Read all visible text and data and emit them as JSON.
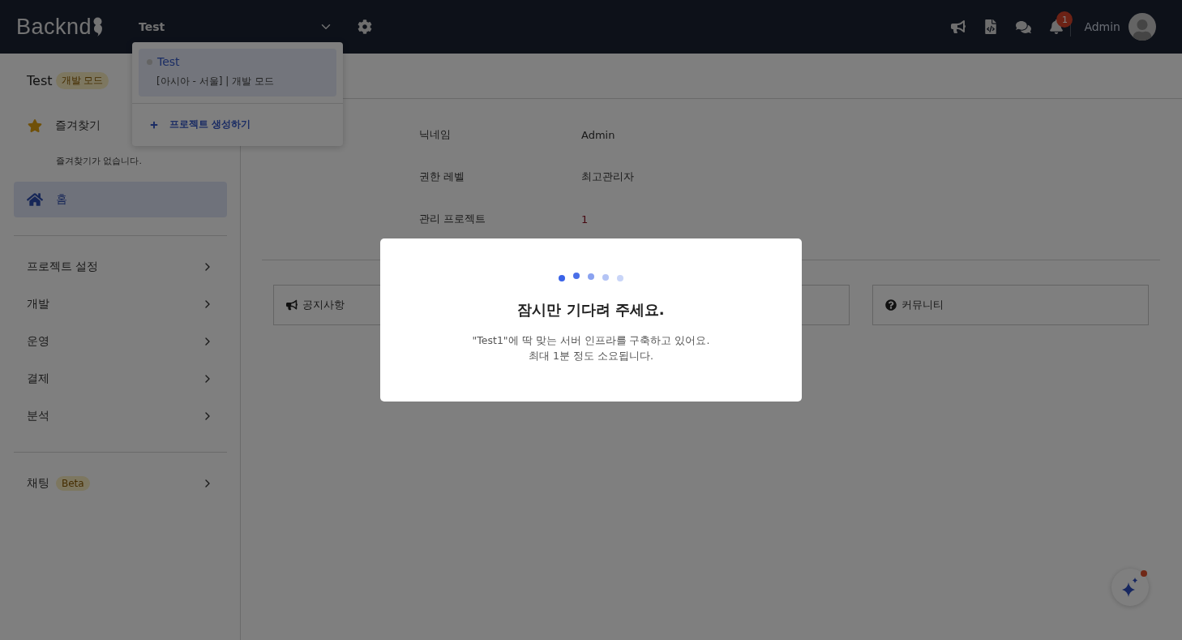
{
  "header": {
    "logo": "Backnd",
    "project_selector": {
      "label": "Test"
    },
    "notification_count": "1",
    "user": {
      "name": "Admin"
    }
  },
  "project_dropdown": {
    "projects": [
      {
        "name": "Test",
        "meta": "[아시아 - 서울] | 개발 모드",
        "selected": true
      }
    ],
    "create_label": "프로젝트 생성하기"
  },
  "sidebar": {
    "project": {
      "name": "Test",
      "badge": "개발 모드"
    },
    "favorites": {
      "title": "즐겨찾기",
      "empty_text": "즐겨찾기가 없습니다."
    },
    "sections": [
      {
        "items": [
          {
            "kind": "home",
            "label": "홈",
            "selected": true
          }
        ]
      },
      {
        "items": [
          {
            "kind": "group",
            "label": "프로젝트 설정",
            "selected": false
          },
          {
            "kind": "group",
            "label": "개발",
            "selected": false
          },
          {
            "kind": "group",
            "label": "운영",
            "selected": false
          },
          {
            "kind": "group",
            "label": "결제",
            "selected": false
          },
          {
            "kind": "group",
            "label": "분석",
            "selected": false
          }
        ]
      },
      {
        "items": [
          {
            "kind": "group",
            "label": "채팅",
            "badge": "Beta",
            "selected": false
          }
        ]
      }
    ]
  },
  "profile": {
    "rows": [
      {
        "kind": "text",
        "label": "닉네임",
        "value": "Admin"
      },
      {
        "kind": "text",
        "label": "권한 레벨",
        "value": "최고관리자"
      },
      {
        "kind": "count",
        "label": "관리 프로젝트",
        "value": "1"
      }
    ]
  },
  "cards": [
    {
      "kind": "megaphone",
      "label": "공지사항"
    },
    {
      "kind": "blank"
    },
    {
      "kind": "question",
      "label": "커뮤니티"
    }
  ],
  "modal": {
    "title": "잠시만 기다려 주세요.",
    "message_lines": [
      "\"Test1\"에 딱 맞는 서버 인프라를 구축하고 있어요.",
      "최대 1분 정도 소요됩니다."
    ]
  }
}
